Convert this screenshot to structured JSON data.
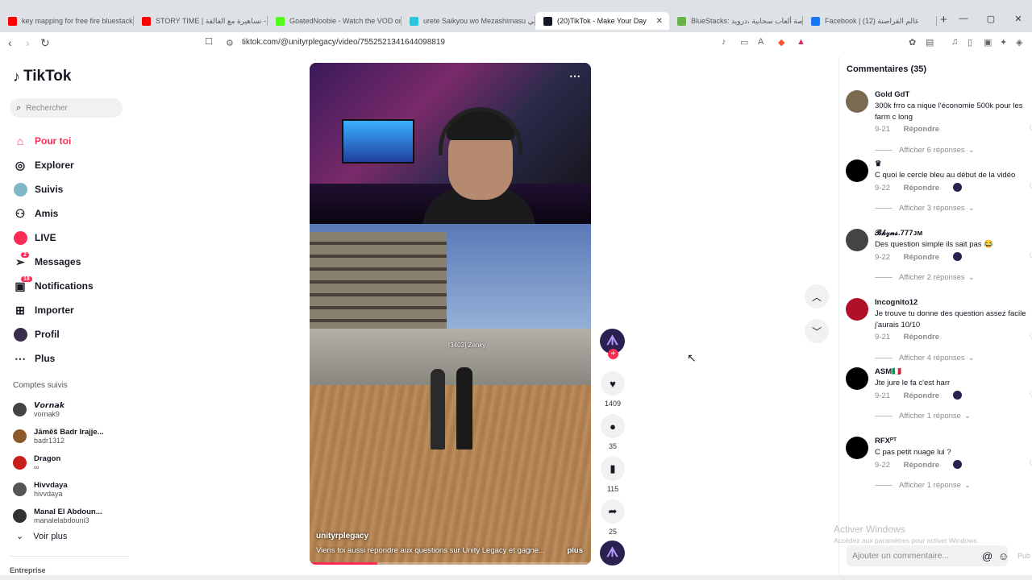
{
  "browser": {
    "tabs": [
      {
        "title": "key mapping for free fire bluestacks",
        "color": "#ff0000"
      },
      {
        "title": "STORY TIME | تساهيرة مع الفالقة - You",
        "color": "#ff0000"
      },
      {
        "title": "GoatedNoobie - Watch the VOD on",
        "color": "#53fc18"
      },
      {
        "title": "urete Saikyou wo Mezashimasu انمي",
        "color": "#29c5d8"
      },
      {
        "title": "(20)TikTok - Make Your Day",
        "color": "#161823",
        "active": true
      },
      {
        "title": "BlueStacks: منصة ألعاب سحابية ،درويد",
        "color": "#6ab04c"
      },
      {
        "title": "Facebook | (12) عالم القراصنة",
        "color": "#1877f2"
      }
    ],
    "url": "tiktok.com/@unityrplegacy/video/7552521341644098819"
  },
  "sidebar": {
    "logo": "TikTok",
    "search_placeholder": "Rechercher",
    "nav": [
      {
        "label": "Pour toi",
        "icon": "home-icon",
        "glyph": "⌂",
        "active": true
      },
      {
        "label": "Explorer",
        "icon": "compass-icon",
        "glyph": "◎"
      },
      {
        "label": "Suivis",
        "icon": "following-avatar-icon",
        "glyph": "◉"
      },
      {
        "label": "Amis",
        "icon": "friends-icon",
        "glyph": "⚇"
      },
      {
        "label": "LIVE",
        "icon": "live-icon",
        "glyph": "◉"
      },
      {
        "label": "Messages",
        "icon": "messages-icon",
        "glyph": "➢",
        "badge": "2"
      },
      {
        "label": "Notifications",
        "icon": "notifications-icon",
        "glyph": "▣",
        "badge": "18"
      },
      {
        "label": "Importer",
        "icon": "upload-icon",
        "glyph": "⊞"
      },
      {
        "label": "Profil",
        "icon": "profile-icon",
        "glyph": "●"
      },
      {
        "label": "Plus",
        "icon": "more-icon",
        "glyph": "⋯"
      }
    ],
    "following_title": "Comptes suivis",
    "following": [
      {
        "name": "𝙑𝙤𝙧𝙣𝙖𝙠",
        "handle": "vornak9",
        "color": "#444"
      },
      {
        "name": "Jāměš Badr Irajje...",
        "handle": "badr1312",
        "color": "#8b5a2b"
      },
      {
        "name": "Dragon",
        "handle": "∞",
        "color": "#c81e1e"
      },
      {
        "name": "Hivvdaya",
        "handle": "hivvdaya",
        "color": "#555"
      },
      {
        "name": "Manal El Abdoun...",
        "handle": "manalelabdouni3",
        "color": "#333"
      }
    ],
    "see_more": "Voir plus",
    "entreprise": "Entreprise"
  },
  "video": {
    "username": "unityrplegacy",
    "description": "Viens toi aussi répondre aux questions sur Unity Legacy et gagne...",
    "more": "plus",
    "nametag": "[3403] Zenky",
    "progress": 0.24
  },
  "actions": {
    "likes": "1409",
    "comments": "35",
    "saves": "115",
    "shares": "25"
  },
  "comments": {
    "title": "Commentaires (35)",
    "items": [
      {
        "author": "Gold GdT",
        "text": "300k frro ca nique l'économie 500k pour les farm c long",
        "date": "9-21",
        "reply": "Répondre",
        "replies": "Afficher 6 réponses",
        "avatar": "#7a6a50",
        "mini": false
      },
      {
        "author": "♛",
        "text": "C quoi le cercle bleu au début de la vidéo",
        "date": "9-22",
        "reply": "Répondre",
        "replies": "Afficher 3 réponses",
        "avatar": "#000000",
        "mini": true
      },
      {
        "author": "𝓑𝓴𝔃𝓷𝓼.777ᴊᴍ",
        "text": "Des question simple ils sait pas 😂",
        "date": "9-22",
        "reply": "Répondre",
        "replies": "Afficher 2 réponses",
        "avatar": "#444444",
        "mini": true
      },
      {
        "author": "Incognito12",
        "text": "Je trouve tu donne des question assez facile j'aurais 10/10",
        "date": "9-21",
        "reply": "Répondre",
        "replies": "Afficher 4 réponses",
        "avatar": "#b0102a",
        "mini": false
      },
      {
        "author": "ASM🇮🇹",
        "text": "Jte jure le fa c'est harr",
        "date": "9-21",
        "reply": "Répondre",
        "replies": "Afficher 1 réponse",
        "avatar": "#000000",
        "mini": true
      },
      {
        "author": "RFXᴾᵀ",
        "text": "C pas petit nuage lui ?",
        "date": "9-22",
        "reply": "Répondre",
        "replies": "Afficher 1 réponse",
        "avatar": "#000000",
        "mini": true
      }
    ],
    "add_placeholder": "Ajouter un commentaire...",
    "publish": "Pub"
  },
  "windows_watermark": {
    "title": "Activer Windows",
    "subtitle": "Accédez aux paramètres pour activer Windows."
  },
  "colors": {
    "accent": "#fe2c55",
    "text": "#161823",
    "muted": "#8a8b91"
  }
}
